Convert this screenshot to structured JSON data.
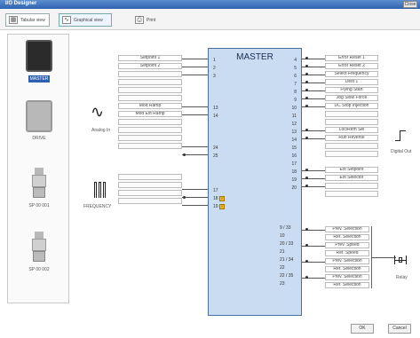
{
  "window": {
    "title": "I/O Designer",
    "close": "Close"
  },
  "toolbar": {
    "views": [
      {
        "label": "Tabular view",
        "icon": "table-icon"
      },
      {
        "label": "Graphical view",
        "icon": "graph-icon",
        "active": true
      },
      {
        "label": "Print",
        "icon": "print-icon"
      }
    ]
  },
  "drives": [
    {
      "label": "MASTER",
      "selected": true
    },
    {
      "label": "DRIVE"
    },
    {
      "label": "SP 00 001"
    },
    {
      "label": "SP 00 002"
    }
  ],
  "master": {
    "title": "MASTER",
    "left_pins": [
      "1",
      "2",
      "3",
      "",
      "",
      "",
      "13",
      "14",
      "",
      "",
      "24",
      "25",
      "",
      "",
      "",
      "17",
      "18",
      "19"
    ],
    "right_pins": [
      "4",
      "5",
      "6",
      "7",
      "8",
      "9",
      "10",
      "11",
      "12",
      "13",
      "14",
      "15",
      "16",
      "17",
      "18",
      "19",
      "20"
    ],
    "lower_pins": [
      "9 / 33",
      "10",
      "20 / 33",
      "21",
      "21 / 34",
      "22",
      "22 / 35",
      "23"
    ]
  },
  "inputs_left": [
    "Setpoint 1",
    "Setpoint 2",
    "",
    "",
    "",
    "",
    "Mod Ramp",
    "Mod Ext Ramp",
    "",
    "",
    "",
    "",
    "",
    "",
    "",
    ""
  ],
  "outputs_right": [
    "Error Reset 1",
    "Error Reset 2",
    "Select Frequency",
    "Dest 1",
    "Flying Start",
    "Jog Slow Force",
    "DC Stop Injection",
    "",
    "",
    "Loc/Rem Sel",
    "Run Reverse",
    "",
    "",
    "Ext Setpoint",
    "Ext Selector",
    "",
    ""
  ],
  "outputs_lower": [
    "Prev. Selection",
    "Ref. Selection",
    "Prev. Speed",
    "Ref. Speed",
    "Prev. Selection",
    "Ref. Selection",
    "Prev. Selection",
    "Ref. Selection"
  ],
  "signals": {
    "analog": "Analog In",
    "frequency": "FREQUENCY",
    "digital_out": "Digital Out",
    "relay": "Relay"
  },
  "buttons": {
    "ok": "OK",
    "cancel": "Cancel"
  },
  "colors": {
    "titlebar": "#2f63b0",
    "master_block": "#c9dcf2",
    "warning": "#f0c020"
  }
}
